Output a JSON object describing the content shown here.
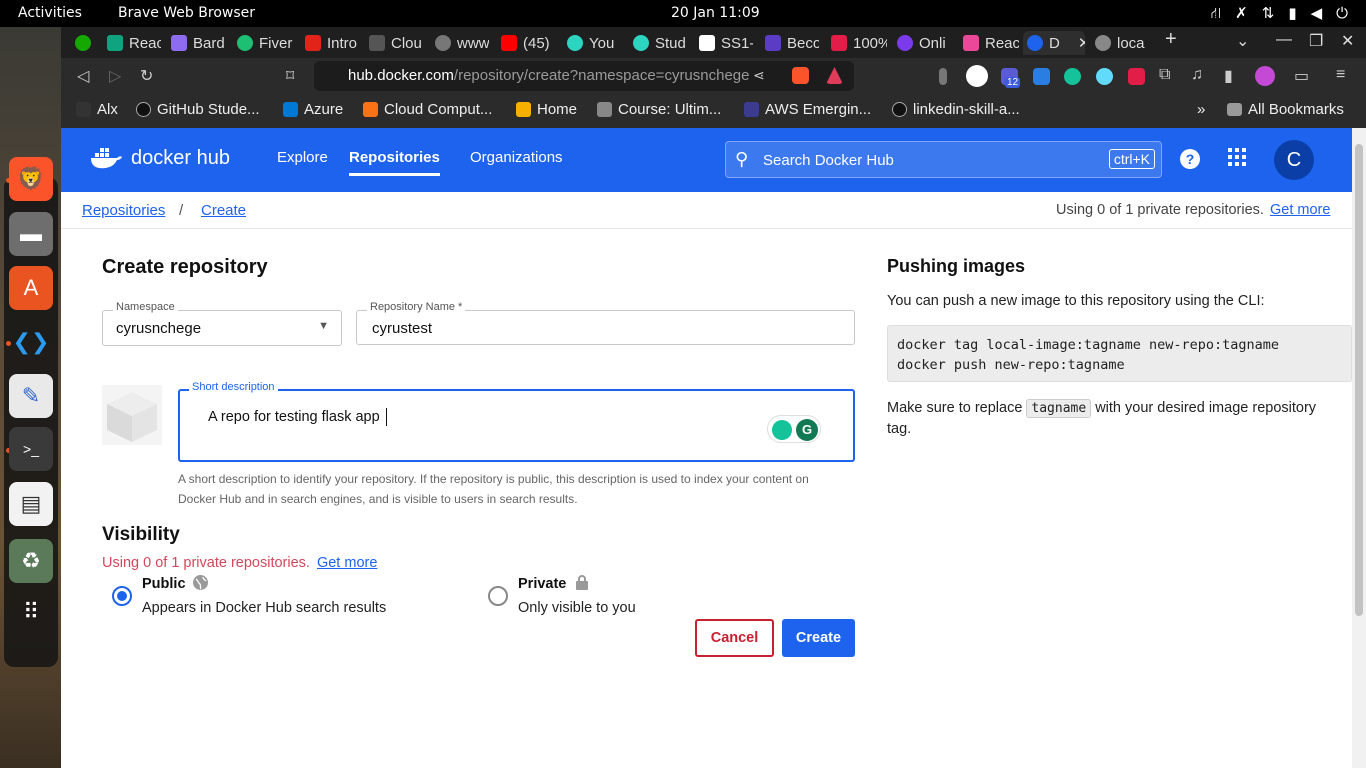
{
  "os": {
    "activities": "Activities",
    "app_name": "Brave Web Browser",
    "clock": "20 Jan  11:09"
  },
  "browser": {
    "tabs": [
      {
        "label": "Reac",
        "color": "#10a37f"
      },
      {
        "label": "Bard",
        "color": "#8e6cf0"
      },
      {
        "label": "Fiver",
        "color": "#1dbf73"
      },
      {
        "label": "Intro",
        "color": "#e2231a"
      },
      {
        "label": "Clou",
        "color": "#555555"
      },
      {
        "label": "www",
        "color": "#777777"
      },
      {
        "label": "(45)",
        "color": "#ff0000"
      },
      {
        "label": "You",
        "color": "#2dd4bf"
      },
      {
        "label": "Stud",
        "color": "#2dd4bf"
      },
      {
        "label": "SS1-",
        "color": "#ffffff"
      },
      {
        "label": "Beco",
        "color": "#5b3cc4"
      },
      {
        "label": "100%",
        "color": "#e11d48"
      },
      {
        "label": "Onli",
        "color": "#7c3aed"
      },
      {
        "label": "Reac",
        "color": "#ec4899"
      },
      {
        "label": "D",
        "color": "#1d63ed"
      },
      {
        "label": "loca",
        "color": "#888888"
      }
    ],
    "url_host": "hub.docker.com",
    "url_path": "/repository/create?namespace=cyrusnchege",
    "extension_badge": "12",
    "bookmarks": [
      {
        "label": "Alx",
        "color": "#333333"
      },
      {
        "label": "GitHub Stude...",
        "color": "#111111"
      },
      {
        "label": "Azure",
        "color": "#0078d4"
      },
      {
        "label": "Cloud Comput...",
        "color": "#f97316"
      },
      {
        "label": "Home",
        "color": "#f5b000"
      },
      {
        "label": "Course: Ultim...",
        "color": "#888888"
      },
      {
        "label": "AWS Emergin...",
        "color": "#3b3b8f"
      },
      {
        "label": "linkedin-skill-a...",
        "color": "#111111"
      }
    ],
    "all_bookmarks": "All Bookmarks"
  },
  "dockerhub": {
    "logo_text": "docker hub",
    "nav": [
      "Explore",
      "Repositories",
      "Organizations"
    ],
    "search_placeholder": "Search Docker Hub",
    "search_shortcut": "ctrl+K",
    "avatar_letter": "C",
    "breadcrumb": [
      "Repositories",
      "Create"
    ],
    "breadcrumb_sep": "/",
    "usage_text": "Using 0 of 1 private repositories.",
    "get_more": "Get more"
  },
  "form": {
    "title": "Create repository",
    "namespace_label": "Namespace",
    "namespace_value": "cyrusnchege",
    "repo_name_label": "Repository Name *",
    "repo_name_value": "cyrustest",
    "short_desc_label": "Short description",
    "short_desc_value": "A repo for testing flask app",
    "short_desc_helper": "A short description to identify your repository. If the repository is public, this description is used to index your content on Docker Hub and in search engines, and is visible to users in search results.",
    "visibility_title": "Visibility",
    "visibility_warning": "Using 0 of 1 private repositories.",
    "visibility_get_more": "Get more",
    "public_label": "Public",
    "public_sub": "Appears in Docker Hub search results",
    "private_label": "Private",
    "private_sub": "Only visible to you",
    "selected": "public",
    "cancel": "Cancel",
    "create": "Create"
  },
  "push": {
    "title": "Pushing images",
    "intro": "You can push a new image to this repository using the CLI:",
    "cmd1": "docker tag local-image:tagname new-repo:tagname",
    "cmd2": "docker push new-repo:tagname",
    "note_before": "Make sure to replace",
    "note_code": "tagname",
    "note_after": "with your desired image repository tag."
  },
  "colors": {
    "docker_blue": "#1d63ed",
    "warning_red": "#d2475b",
    "cancel_red": "#c8202f"
  }
}
